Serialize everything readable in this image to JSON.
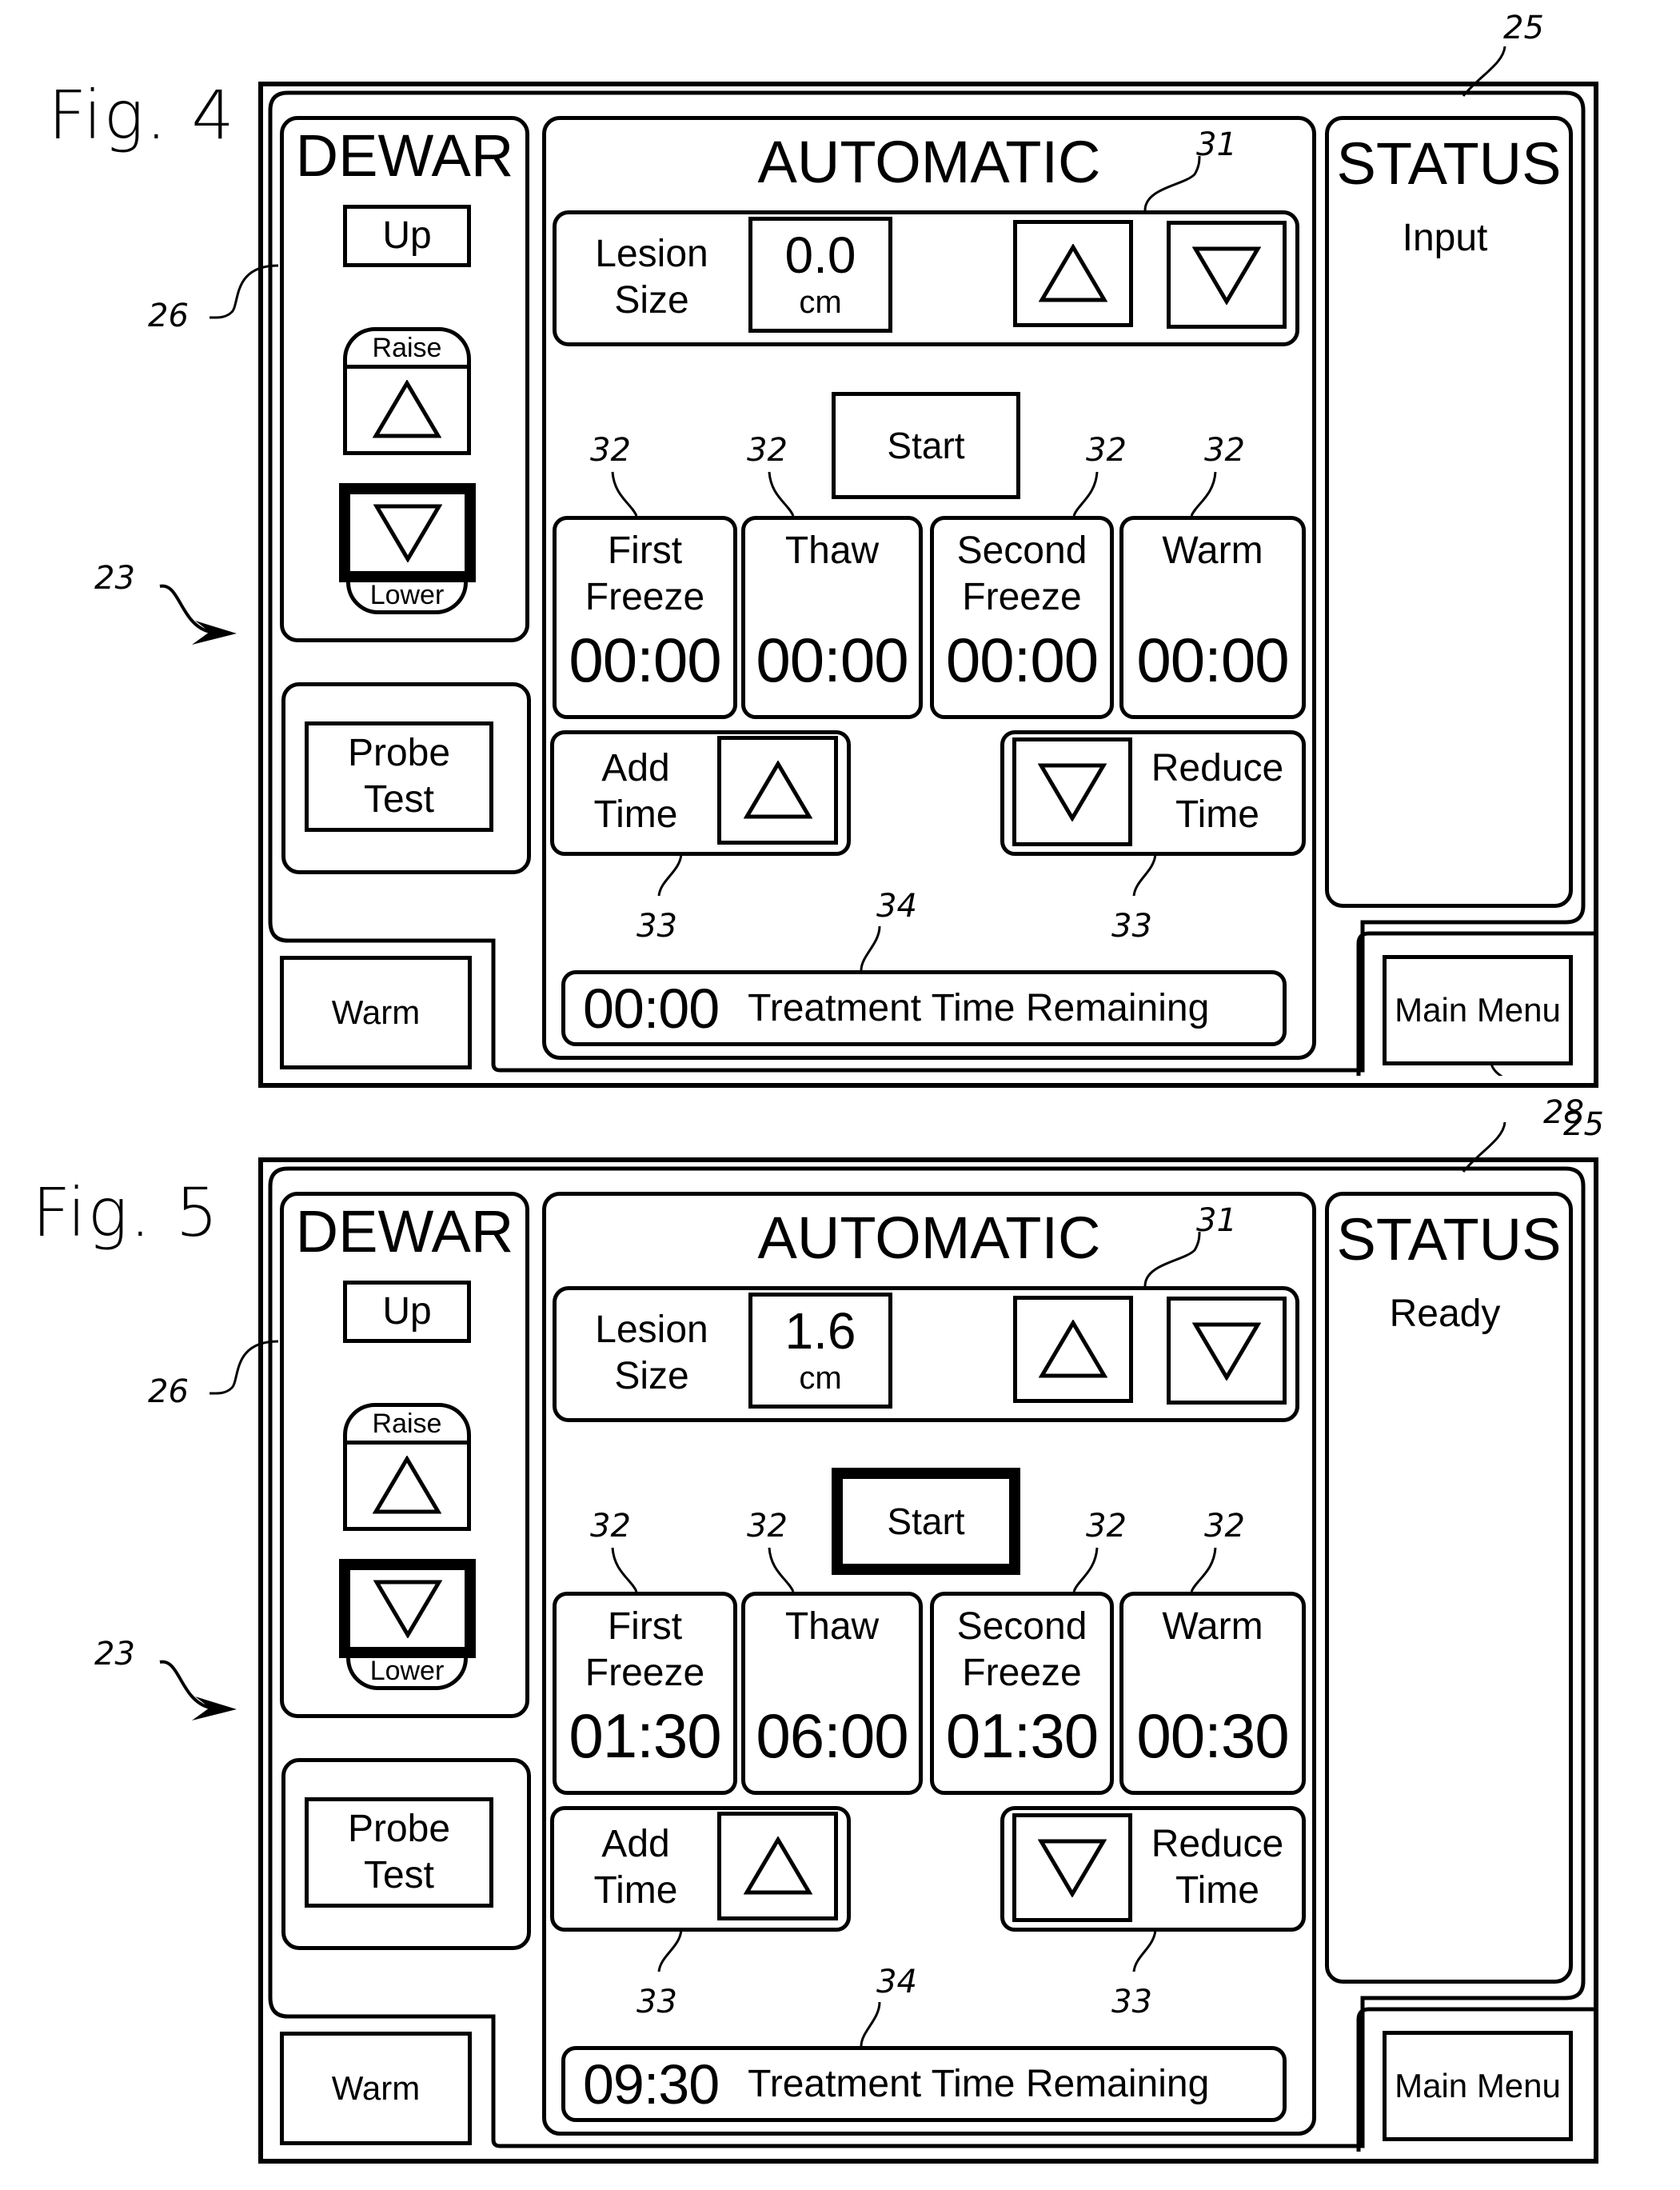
{
  "figures": [
    {
      "fig_label": "Fig. 4",
      "dewar": {
        "title": "DEWAR",
        "up_label": "Up",
        "raise_label": "Raise",
        "lower_label": "Lower",
        "raise_icon": "triangle-up-icon",
        "lower_icon": "triangle-down-icon",
        "lower_selected": true
      },
      "probe_test_label": "Probe\nTest",
      "warm_button_label": "Warm",
      "automatic": {
        "title": "AUTOMATIC",
        "lesion_label": "Lesion\nSize",
        "lesion_value": "0.0",
        "lesion_unit": "cm",
        "start_label": "Start",
        "start_highlighted": false,
        "timers": [
          {
            "label": "First\nFreeze",
            "value": "00:00"
          },
          {
            "label": "Thaw",
            "value": "00:00"
          },
          {
            "label": "Second\nFreeze",
            "value": "00:00"
          },
          {
            "label": "Warm",
            "value": "00:00"
          }
        ],
        "add_time_label": "Add\nTime",
        "reduce_time_label": "Reduce\nTime",
        "treatment_time_value": "00:00",
        "treatment_time_label": "Treatment Time Remaining"
      },
      "status": {
        "title": "STATUS",
        "value": "Input"
      },
      "main_menu_label": "Main Menu",
      "refs": {
        "r25": "25",
        "r26": "26",
        "r23": "23",
        "r31": "31",
        "r32a": "32",
        "r32b": "32",
        "r32c": "32",
        "r32d": "32",
        "r33a": "33",
        "r33b": "33",
        "r34": "34",
        "r28": "28"
      }
    },
    {
      "fig_label": "Fig. 5",
      "dewar": {
        "title": "DEWAR",
        "up_label": "Up",
        "raise_label": "Raise",
        "lower_label": "Lower",
        "raise_icon": "triangle-up-icon",
        "lower_icon": "triangle-down-icon",
        "lower_selected": true
      },
      "probe_test_label": "Probe\nTest",
      "warm_button_label": "Warm",
      "automatic": {
        "title": "AUTOMATIC",
        "lesion_label": "Lesion\nSize",
        "lesion_value": "1.6",
        "lesion_unit": "cm",
        "start_label": "Start",
        "start_highlighted": true,
        "timers": [
          {
            "label": "First\nFreeze",
            "value": "01:30"
          },
          {
            "label": "Thaw",
            "value": "06:00"
          },
          {
            "label": "Second\nFreeze",
            "value": "01:30"
          },
          {
            "label": "Warm",
            "value": "00:30"
          }
        ],
        "add_time_label": "Add\nTime",
        "reduce_time_label": "Reduce\nTime",
        "treatment_time_value": "09:30",
        "treatment_time_label": "Treatment Time Remaining"
      },
      "status": {
        "title": "STATUS",
        "value": "Ready"
      },
      "main_menu_label": "Main Menu",
      "refs": {
        "r25": "25",
        "r26": "26",
        "r23": "23",
        "r31": "31",
        "r32a": "32",
        "r32b": "32",
        "r32c": "32",
        "r32d": "32",
        "r33a": "33",
        "r33b": "33",
        "r34": "34"
      }
    }
  ]
}
